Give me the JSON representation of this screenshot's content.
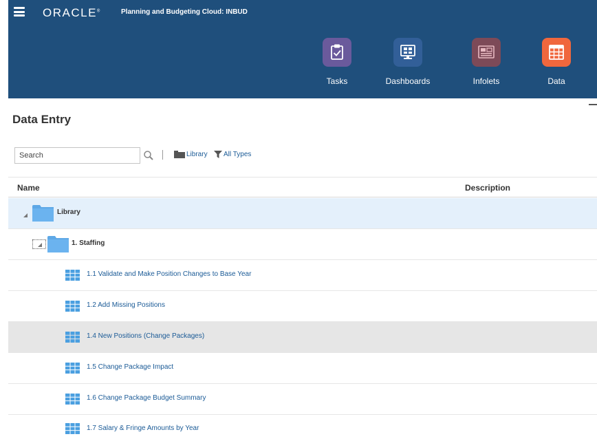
{
  "header": {
    "logo_text": "ORACLE",
    "logo_mark": "®",
    "app_title": "Planning and Budgeting Cloud: INBUD",
    "nav": [
      {
        "label": "Tasks",
        "icon": "tasks-clipboard-icon",
        "color": "#6a5a9c"
      },
      {
        "label": "Dashboards",
        "icon": "dashboards-monitor-icon",
        "color": "#325f98"
      },
      {
        "label": "Infolets",
        "icon": "infolets-icon",
        "color": "#7d4a58"
      },
      {
        "label": "Data",
        "icon": "data-grid-icon",
        "color": "#f0673d"
      }
    ]
  },
  "page": {
    "title": "Data Entry"
  },
  "toolbar": {
    "search_placeholder": "Search",
    "library_filter": "Library",
    "type_filter": "All Types"
  },
  "table": {
    "columns": [
      "Name",
      "Description"
    ],
    "rows": [
      {
        "label": "Library",
        "kind": "folder",
        "level": 0,
        "state": "selected"
      },
      {
        "label": "1. Staffing",
        "kind": "folder",
        "level": 1,
        "state": "focused"
      },
      {
        "label": "1.1 Validate and Make Position Changes to Base Year",
        "kind": "form",
        "level": 2,
        "state": ""
      },
      {
        "label": "1.2 Add Missing Positions",
        "kind": "form",
        "level": 2,
        "state": ""
      },
      {
        "label": "1.4 New Positions (Change Packages)",
        "kind": "form",
        "level": 2,
        "state": "hover"
      },
      {
        "label": "1.5 Change Package Impact",
        "kind": "form",
        "level": 2,
        "state": ""
      },
      {
        "label": "1.6 Change Package Budget Summary",
        "kind": "form",
        "level": 2,
        "state": ""
      },
      {
        "label": "1.7 Salary & Fringe Amounts by Year",
        "kind": "form",
        "level": 2,
        "state": ""
      }
    ]
  },
  "colors": {
    "header_bg": "#1f4f7c",
    "folder_blue": "#5ea8e6",
    "form_blue": "#4a9fe0",
    "link_blue": "#1a5a96",
    "selected_row": "#e4f0fb",
    "hover_row": "#e6e6e6"
  }
}
